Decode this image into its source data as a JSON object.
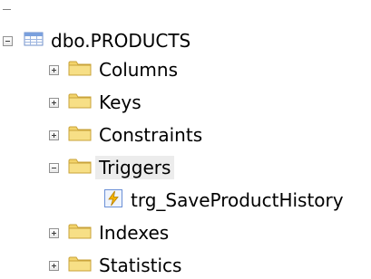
{
  "tree": {
    "table": {
      "label": "dbo.PRODUCTS",
      "expanded": true,
      "icon": "table-icon"
    },
    "children": {
      "columns": {
        "label": "Columns",
        "expanded": false,
        "icon": "folder-icon"
      },
      "keys": {
        "label": "Keys",
        "expanded": false,
        "icon": "folder-icon"
      },
      "constraints": {
        "label": "Constraints",
        "expanded": false,
        "icon": "folder-icon"
      },
      "triggers": {
        "label": "Triggers",
        "expanded": true,
        "icon": "folder-icon",
        "selected": true,
        "items": [
          {
            "label": "trg_SaveProductHistory",
            "icon": "trigger-icon"
          }
        ]
      },
      "indexes": {
        "label": "Indexes",
        "expanded": false,
        "icon": "folder-icon"
      },
      "statistics": {
        "label": "Statistics",
        "expanded": false,
        "icon": "folder-icon"
      }
    }
  },
  "colors": {
    "folder": "#f2d36b",
    "folder_outline": "#c9a33a",
    "selection": "#ececec",
    "trigger_bolt": "#f5b400",
    "trigger_frame": "#6a8fd6"
  }
}
